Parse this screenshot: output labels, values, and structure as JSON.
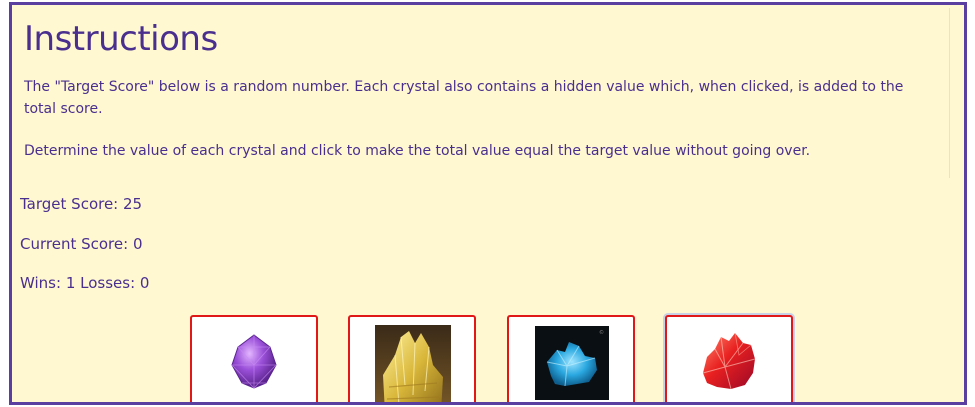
{
  "instructions": {
    "heading": "Instructions",
    "paragraph_1": "The \"Target Score\" below is a random number. Each crystal also contains a hidden value which, when clicked, is added to the total score.",
    "paragraph_2": "Determine the value of each crystal and click to make the total value equal the target value without going over."
  },
  "scoreboard": {
    "target_score": "Target Score: 25",
    "current_score": "Current Score: 0",
    "record": "Wins: 1 Losses: 0"
  },
  "crystals": [
    {
      "icon": "purple-crystal-icon",
      "color": "#8b3fcf"
    },
    {
      "icon": "yellow-crystal-icon",
      "color": "#d8b83a"
    },
    {
      "icon": "blue-crystal-icon",
      "color": "#2aa8e0"
    },
    {
      "icon": "red-crystal-icon",
      "color": "#e82020"
    }
  ],
  "colors": {
    "text": "#4a2f8f",
    "background": "#fff8d1",
    "border": "#5b3fa0",
    "crystal_border": "#e01818"
  }
}
